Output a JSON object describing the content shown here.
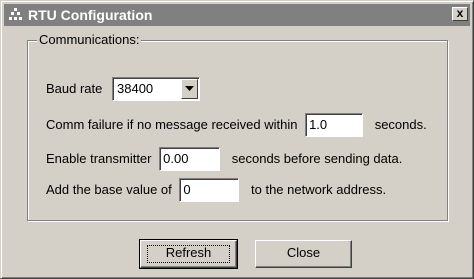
{
  "window": {
    "title": "RTU Configuration",
    "close_label": "x"
  },
  "group": {
    "legend": "Communications:"
  },
  "baud": {
    "label": "Baud rate",
    "value": "38400"
  },
  "comm_failure": {
    "prefix": "Comm failure if no message received within",
    "value": "1.0",
    "suffix": "seconds."
  },
  "transmitter": {
    "prefix": "Enable transmitter",
    "value": "0.00",
    "suffix": "seconds before sending data."
  },
  "address": {
    "prefix": "Add the base value of",
    "value": "0",
    "suffix": "to the network address."
  },
  "buttons": {
    "refresh": "Refresh",
    "close": "Close"
  }
}
